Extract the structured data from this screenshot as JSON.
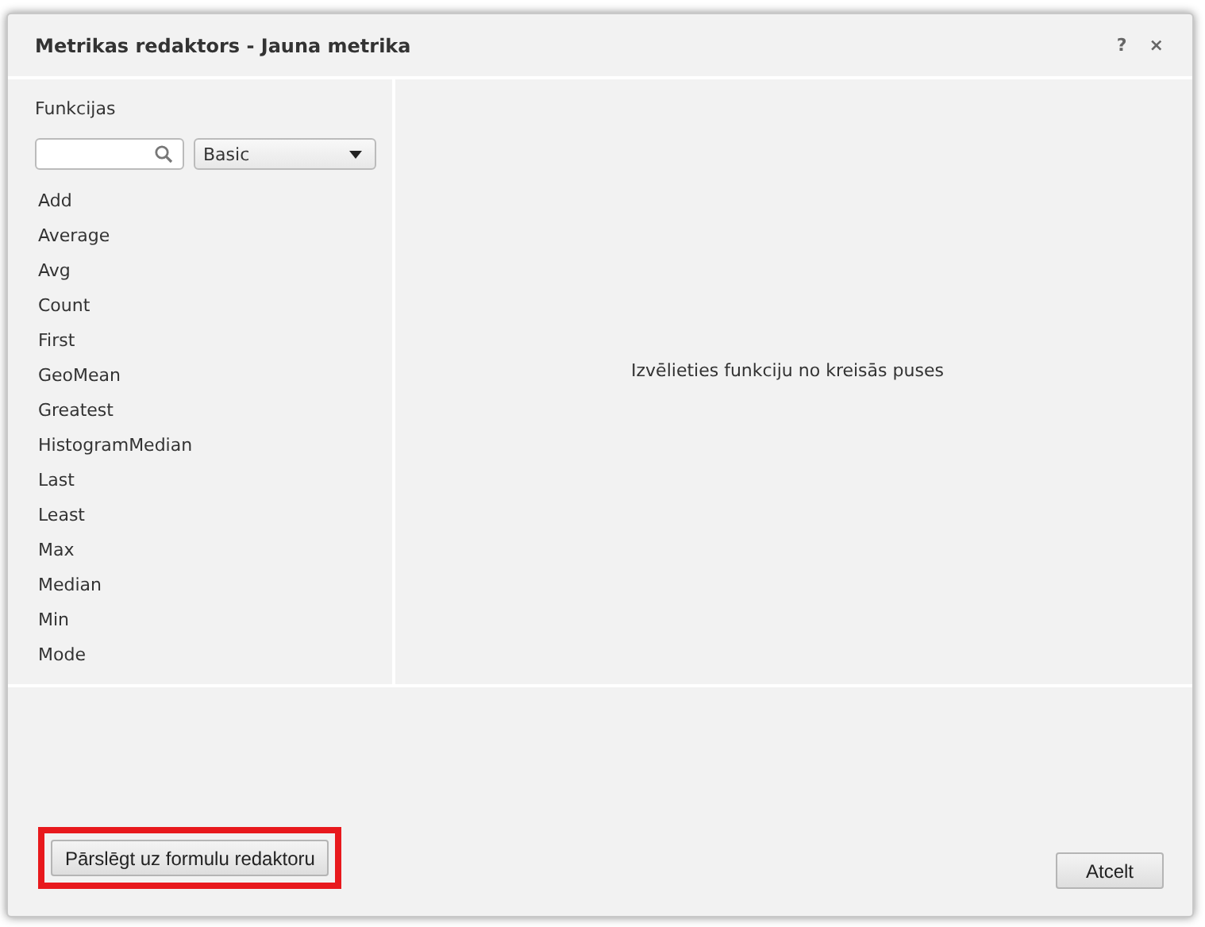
{
  "dialog": {
    "title": "Metrikas redaktors - Jauna metrika",
    "help": "?",
    "close": "×"
  },
  "functions": {
    "heading": "Funkcijas",
    "category": "Basic",
    "items": [
      "Add",
      "Average",
      "Avg",
      "Count",
      "First",
      "GeoMean",
      "Greatest",
      "HistogramMedian",
      "Last",
      "Least",
      "Max",
      "Median",
      "Min",
      "Mode"
    ]
  },
  "detail": {
    "message": "Izvēlieties funkciju no kreisās puses"
  },
  "footer": {
    "switch_button": {
      "label": "Pārslēgt uz formulu redaktoru",
      "highlighted": true
    },
    "cancel_button": {
      "label": "Atcelt"
    }
  }
}
